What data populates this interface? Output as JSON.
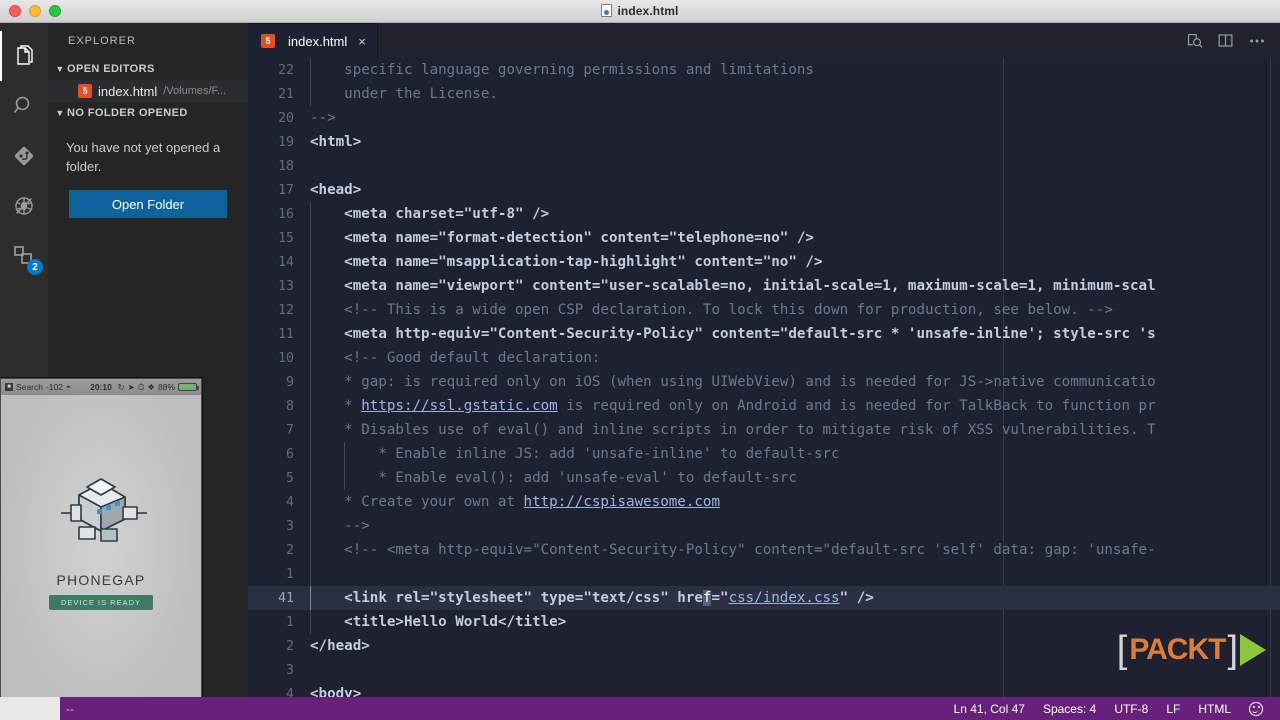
{
  "window": {
    "title": "index.html",
    "traffic_lights": [
      "close",
      "minimize",
      "zoom"
    ]
  },
  "activitybar": {
    "items": [
      {
        "name": "explorer",
        "icon": "files-icon",
        "active": true,
        "badge": ""
      },
      {
        "name": "search",
        "icon": "search-icon",
        "active": false,
        "badge": ""
      },
      {
        "name": "source-control",
        "icon": "source-control-icon",
        "active": false,
        "badge": ""
      },
      {
        "name": "debug",
        "icon": "debug-icon",
        "active": false,
        "badge": ""
      },
      {
        "name": "extensions",
        "icon": "extensions-icon",
        "active": false,
        "badge": "2"
      }
    ]
  },
  "sidebar": {
    "title": "EXPLORER",
    "open_editors": {
      "label": "OPEN EDITORS",
      "expanded": true,
      "items": [
        {
          "name": "index.html",
          "path": "/Volumes/F...",
          "icon": "html5-icon"
        }
      ]
    },
    "no_folder": {
      "label": "NO FOLDER OPENED",
      "expanded": true,
      "message": "You have not yet opened a folder.",
      "button_label": "Open Folder"
    }
  },
  "tabs": [
    {
      "label": "index.html",
      "icon": "html5-icon",
      "active": true,
      "close": "×"
    }
  ],
  "editor_actions": [
    {
      "name": "open-preview",
      "icon": "preview-icon"
    },
    {
      "name": "split-editor",
      "icon": "split-editor-icon"
    },
    {
      "name": "more-actions",
      "icon": "ellipsis-icon"
    }
  ],
  "editor": {
    "language": "HTML",
    "lines": [
      {
        "num": "22",
        "indent": 2,
        "guides": 1,
        "tokens": [
          {
            "c": "com",
            "t": "    specific language governing permissions and limitations"
          }
        ]
      },
      {
        "num": "21",
        "indent": 2,
        "guides": 1,
        "tokens": [
          {
            "c": "com",
            "t": "    under the License."
          }
        ]
      },
      {
        "num": "20",
        "indent": 0,
        "guides": 0,
        "tokens": [
          {
            "c": "com",
            "t": "-->"
          }
        ]
      },
      {
        "num": "19",
        "indent": 0,
        "guides": 0,
        "tokens": [
          {
            "c": "tag",
            "t": "<html>"
          }
        ]
      },
      {
        "num": "18",
        "indent": 0,
        "guides": 0,
        "tokens": []
      },
      {
        "num": "17",
        "indent": 0,
        "guides": 0,
        "tokens": [
          {
            "c": "tag",
            "t": "<head>"
          }
        ]
      },
      {
        "num": "16",
        "indent": 1,
        "guides": 1,
        "tokens": [
          {
            "c": "tag",
            "t": "    <meta charset=\"utf-8\" />"
          }
        ]
      },
      {
        "num": "15",
        "indent": 1,
        "guides": 1,
        "tokens": [
          {
            "c": "tag",
            "t": "    <meta name=\"format-detection\" content=\"telephone=no\" />"
          }
        ]
      },
      {
        "num": "14",
        "indent": 1,
        "guides": 1,
        "tokens": [
          {
            "c": "tag",
            "t": "    <meta name=\"msapplication-tap-highlight\" content=\"no\" />"
          }
        ]
      },
      {
        "num": "13",
        "indent": 1,
        "guides": 1,
        "tokens": [
          {
            "c": "tag",
            "t": "    <meta name=\"viewport\" content=\"user-scalable=no, initial-scale=1, maximum-scale=1, minimum-scal"
          }
        ]
      },
      {
        "num": "12",
        "indent": 1,
        "guides": 1,
        "tokens": [
          {
            "c": "com",
            "t": "    <!-- This is a wide open CSP declaration. To lock this down for production, see below. -->"
          }
        ]
      },
      {
        "num": "11",
        "indent": 1,
        "guides": 1,
        "tokens": [
          {
            "c": "tag",
            "t": "    <meta http-equiv=\"Content-Security-Policy\" content=\"default-src * 'unsafe-inline'; style-src 's"
          }
        ]
      },
      {
        "num": "10",
        "indent": 1,
        "guides": 1,
        "tokens": [
          {
            "c": "com",
            "t": "    <!-- Good default declaration:"
          }
        ]
      },
      {
        "num": "9",
        "indent": 1,
        "guides": 1,
        "tokens": [
          {
            "c": "com",
            "t": "    * gap: is required only on iOS (when using UIWebView) and is needed for JS->native communicatio"
          }
        ]
      },
      {
        "num": "8",
        "indent": 1,
        "guides": 1,
        "tokens": [
          {
            "c": "com",
            "t": "    * "
          },
          {
            "c": "link",
            "t": "https://ssl.gstatic.com"
          },
          {
            "c": "com",
            "t": " is required only on Android and is needed for TalkBack to function pr"
          }
        ]
      },
      {
        "num": "7",
        "indent": 1,
        "guides": 1,
        "tokens": [
          {
            "c": "com",
            "t": "    * Disables use of eval() and inline scripts in order to mitigate risk of XSS vulnerabilities. T"
          }
        ]
      },
      {
        "num": "6",
        "indent": 2,
        "guides": 2,
        "tokens": [
          {
            "c": "com",
            "t": "        * Enable inline JS: add 'unsafe-inline' to default-src"
          }
        ]
      },
      {
        "num": "5",
        "indent": 2,
        "guides": 2,
        "tokens": [
          {
            "c": "com",
            "t": "        * Enable eval(): add 'unsafe-eval' to default-src"
          }
        ]
      },
      {
        "num": "4",
        "indent": 1,
        "guides": 1,
        "tokens": [
          {
            "c": "com",
            "t": "    * Create your own at "
          },
          {
            "c": "link",
            "t": "http://cspisawesome.com"
          }
        ]
      },
      {
        "num": "3",
        "indent": 1,
        "guides": 1,
        "tokens": [
          {
            "c": "com",
            "t": "    -->"
          }
        ]
      },
      {
        "num": "2",
        "indent": 1,
        "guides": 1,
        "tokens": [
          {
            "c": "com",
            "t": "    <!-- <meta http-equiv=\"Content-Security-Policy\" content=\"default-src 'self' data: gap: 'unsafe-"
          }
        ]
      },
      {
        "num": "1",
        "indent": 1,
        "guides": 1,
        "tokens": []
      },
      {
        "num": "41",
        "indent": 1,
        "guides": 1,
        "cursor": true,
        "tokens": [
          {
            "c": "tag",
            "t": "    <link rel=\"stylesheet\" type=\"text/css\" hre"
          },
          {
            "c": "caret",
            "t": "f"
          },
          {
            "c": "tag",
            "t": "=\""
          },
          {
            "c": "link",
            "t": "css/index.css"
          },
          {
            "c": "tag",
            "t": "\" />"
          }
        ]
      },
      {
        "num": "1",
        "indent": 1,
        "guides": 1,
        "tokens": [
          {
            "c": "tag",
            "t": "    <title>Hello World</title>"
          }
        ]
      },
      {
        "num": "2",
        "indent": 0,
        "guides": 0,
        "tokens": [
          {
            "c": "tag",
            "t": "</head>"
          }
        ]
      },
      {
        "num": "3",
        "indent": 0,
        "guides": 0,
        "tokens": []
      },
      {
        "num": "4",
        "indent": 0,
        "guides": 0,
        "tokens": [
          {
            "c": "tag",
            "t": "<body>"
          }
        ]
      }
    ]
  },
  "simulator": {
    "status": {
      "carrier": "Search",
      "signal": "-102",
      "time": "20:10",
      "battery_percent": "88%"
    },
    "app": {
      "name": "PHONEGAP",
      "ready_label": "DEVICE IS READY"
    }
  },
  "watermark": {
    "bracket_left": "[",
    "word": "PACKT",
    "bracket_right": "]"
  },
  "statusbar": {
    "left_text": "--",
    "items": [
      {
        "name": "cursor-position",
        "label": "Ln 41, Col 47"
      },
      {
        "name": "indentation",
        "label": "Spaces: 4"
      },
      {
        "name": "encoding",
        "label": "UTF-8"
      },
      {
        "name": "eol",
        "label": "LF"
      },
      {
        "name": "language-mode",
        "label": "HTML"
      }
    ],
    "feedback_icon": "smiley-icon"
  },
  "colors": {
    "statusbar_bg": "#68217a",
    "editor_bg": "#1e2230",
    "sidebar_bg": "#252526",
    "accent_blue": "#0e639c",
    "html_orange": "#e44d26"
  }
}
